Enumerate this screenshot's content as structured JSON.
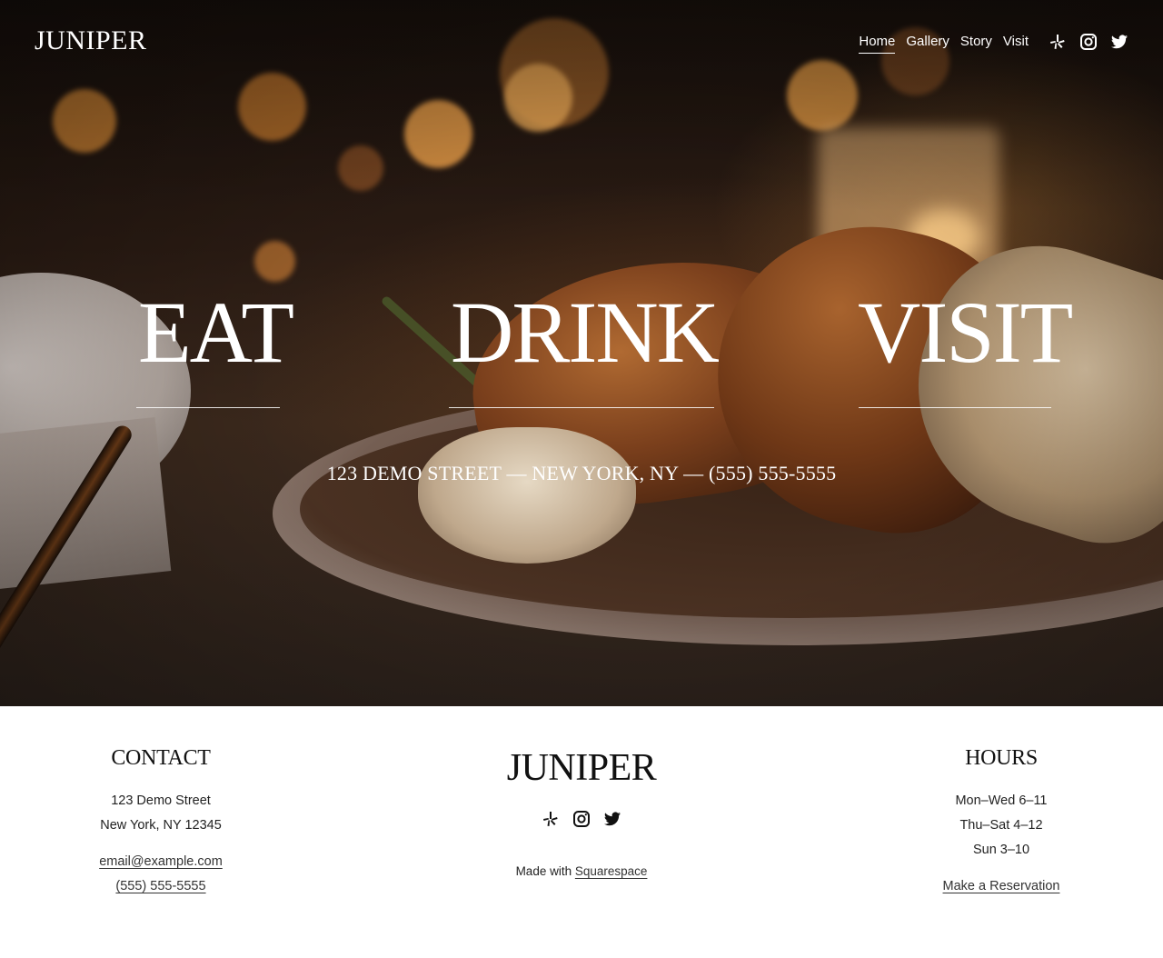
{
  "site": {
    "logo": "JUNIPER"
  },
  "nav": {
    "items": [
      {
        "label": "Home",
        "active": true
      },
      {
        "label": "Gallery",
        "active": false
      },
      {
        "label": "Story",
        "active": false
      },
      {
        "label": "Visit",
        "active": false
      }
    ]
  },
  "social": {
    "icons": [
      "yelp-icon",
      "instagram-icon",
      "twitter-icon"
    ]
  },
  "hero": {
    "words": [
      "EAT",
      "DRINK",
      "VISIT"
    ],
    "address": "123 DEMO STREET — NEW YORK, NY — (555) 555-5555"
  },
  "footer": {
    "contact": {
      "heading": "CONTACT",
      "street": "123 Demo Street",
      "city": "New York, NY 12345",
      "email": "email@example.com",
      "phone": "(555) 555-5555"
    },
    "center": {
      "logo": "JUNIPER",
      "made_with": "Made with",
      "made_link": "Squarespace"
    },
    "hours": {
      "heading": "HOURS",
      "lines": [
        "Mon–Wed 6–11",
        "Thu–Sat 4–12",
        "Sun 3–10"
      ],
      "reservation": "Make a Reservation"
    }
  },
  "colors": {
    "hero_text": "#ffffff",
    "footer_text": "#111111",
    "footer_bg": "#ffffff"
  }
}
